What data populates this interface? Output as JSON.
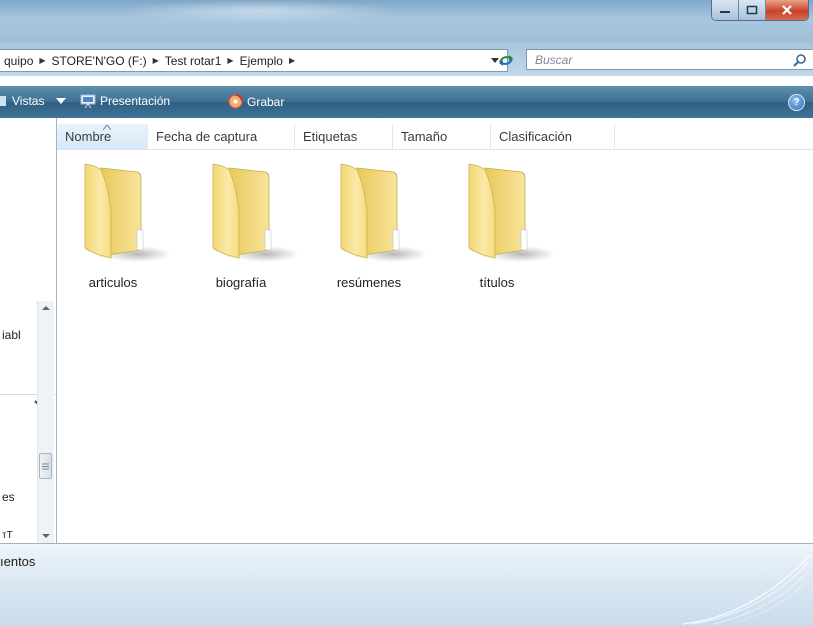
{
  "window": {
    "buttons": {
      "minimize": "minimize",
      "maximize": "maximize",
      "close": "close"
    }
  },
  "address": {
    "crumbs": [
      "quipo",
      "STORE'N'GO (F:)",
      "Test rotar1",
      "Ejemplo"
    ],
    "search_placeholder": "Buscar"
  },
  "toolbar": {
    "views_label": "Vistas",
    "slideshow_label": "Presentación",
    "burn_label": "Grabar"
  },
  "navpane": {
    "items": [
      "iabl",
      "es",
      "ᴛT"
    ]
  },
  "columns": [
    "Nombre",
    "Fecha de captura",
    "Etiquetas",
    "Tamaño",
    "Clasificación"
  ],
  "folders": [
    {
      "name": "articulos"
    },
    {
      "name": "biografía"
    },
    {
      "name": "resúmenes"
    },
    {
      "name": "títulos"
    }
  ],
  "details": {
    "text": "ıentos"
  },
  "colors": {
    "toolbar": "#3e6f91",
    "folder": "#f3dc7a",
    "accent": "#2c6bb0"
  }
}
